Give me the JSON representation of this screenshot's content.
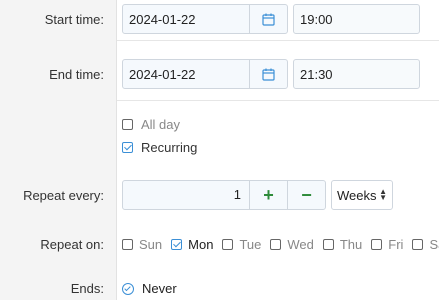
{
  "labels": {
    "start_time": "Start time:",
    "end_time": "End time:",
    "repeat_every": "Repeat every:",
    "repeat_on": "Repeat on:",
    "ends": "Ends:"
  },
  "start": {
    "date": "2024-01-22",
    "time": "19:00"
  },
  "end": {
    "date": "2024-01-22",
    "time": "21:30"
  },
  "options": {
    "all_day": {
      "label": "All day",
      "checked": false
    },
    "recurring": {
      "label": "Recurring",
      "checked": true
    }
  },
  "repeat": {
    "every_value": "1",
    "increment_symbol": "+",
    "decrement_symbol": "−",
    "unit": "Weeks"
  },
  "repeat_on": [
    {
      "label": "Sun",
      "checked": false
    },
    {
      "label": "Mon",
      "checked": true
    },
    {
      "label": "Tue",
      "checked": false
    },
    {
      "label": "Wed",
      "checked": false
    },
    {
      "label": "Thu",
      "checked": false
    },
    {
      "label": "Fri",
      "checked": false
    },
    {
      "label": "Sat",
      "checked": false
    }
  ],
  "ends": {
    "label": "Never",
    "selected": true
  },
  "colors": {
    "accent": "#3b8fd6",
    "stepper_green": "#2e8b3a",
    "field_bg": "#f5f9fd"
  },
  "icons": {
    "calendar": "calendar-icon",
    "check": "check-icon",
    "select": "chevron-up-down-icon"
  }
}
